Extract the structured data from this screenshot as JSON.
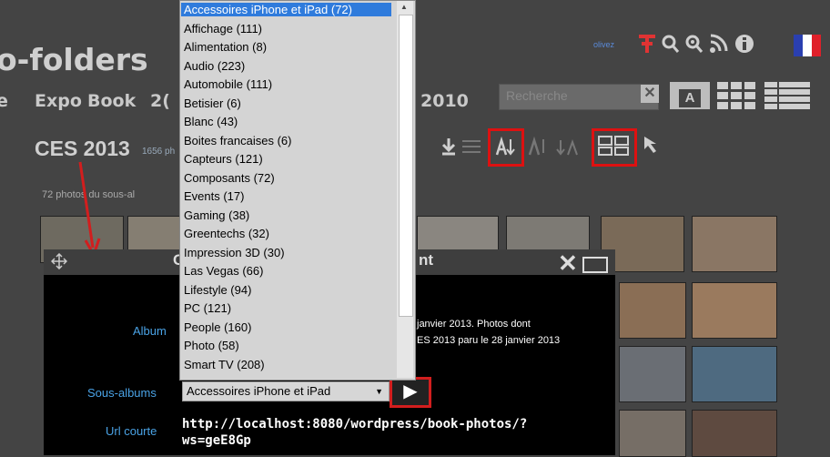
{
  "header": {
    "brand": "o-folders",
    "live_badge": "olivez",
    "nav": [
      "e",
      "Expo",
      "Book",
      "2(",
      "2010"
    ],
    "search_placeholder": "Recherche",
    "search_clear": "✕",
    "view_A": "A"
  },
  "album": {
    "title": "CES 2013",
    "count": "1656 ph",
    "sub_count": "72 photos du sous-al"
  },
  "dropdown": {
    "options": [
      "Accessoires iPhone et iPad (72)",
      "Affichage (111)",
      "Alimentation (8)",
      "Audio (223)",
      "Automobile (111)",
      "Betisier (6)",
      "Blanc (43)",
      "Boites francaises (6)",
      "Capteurs (121)",
      "Composants (72)",
      "Events (17)",
      "Gaming (38)",
      "Greentechs (32)",
      "Impression 3D (30)",
      "Las Vegas (66)",
      "Lifestyle (94)",
      "PC (121)",
      "People (160)",
      "Photo (58)",
      "Smart TV (208)"
    ],
    "selected_index": 0
  },
  "dialog": {
    "title_left": "C",
    "title_right": "nt",
    "album_label": "Album",
    "album_desc_1": "janvier 2013. Photos dont",
    "album_desc_2": "ES 2013 paru le 28 janvier 2013",
    "subalbums_label": "Sous-albums",
    "subalbums_value": "Accessoires iPhone et iPad",
    "go_button": "▶",
    "url_label": "Url courte",
    "url_value_1": "http://localhost:8080/wordpress/book-photos/?",
    "url_value_2": "ws=geE8Gp"
  },
  "colors": {
    "accent_red": "#d21e1e",
    "selected_blue": "#2f7bdc",
    "label_blue": "#4aa3e6"
  }
}
